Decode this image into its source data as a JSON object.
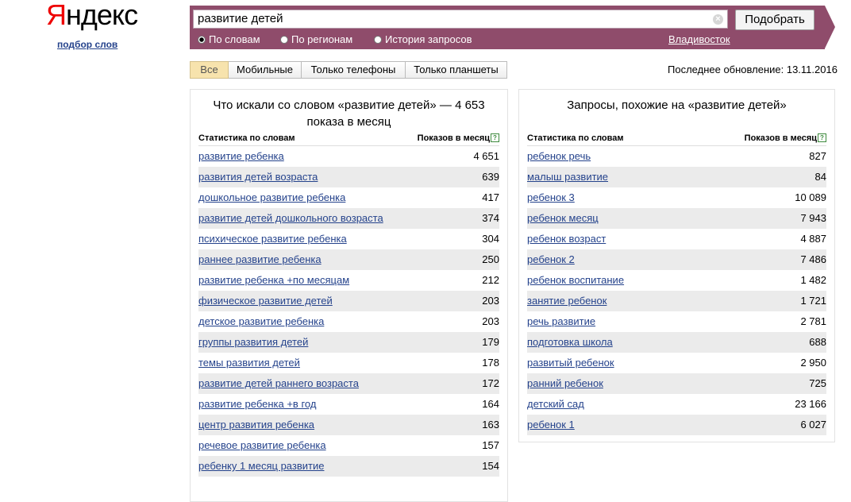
{
  "logo": {
    "first": "Я",
    "rest": "ндекс",
    "subtitle": "подбор слов"
  },
  "search": {
    "value": "развитие детей",
    "clear_icon": "×",
    "submit_label": "Подобрать"
  },
  "radios": [
    {
      "label": "По словам",
      "selected": true
    },
    {
      "label": "По регионам",
      "selected": false
    },
    {
      "label": "История запросов",
      "selected": false
    }
  ],
  "region": "Владивосток",
  "tabs": [
    {
      "label": "Все",
      "active": true
    },
    {
      "label": "Мобильные",
      "active": false
    },
    {
      "label": "Только телефоны",
      "active": false
    },
    {
      "label": "Только планшеты",
      "active": false
    }
  ],
  "last_update": "Последнее обновление: 13.11.2016",
  "left": {
    "title": "Что искали со словом «развитие детей» — 4 653 показа в месяц",
    "col_keyword": "Статистика по словам",
    "col_count": "Показов в месяц",
    "help_icon": "?",
    "rows": [
      {
        "keyword": "развитие ребенка",
        "count": "4 651"
      },
      {
        "keyword": "развития детей возраста",
        "count": "639"
      },
      {
        "keyword": "дошкольное развитие ребенка",
        "count": "417"
      },
      {
        "keyword": "развитие детей дошкольного возраста",
        "count": "374"
      },
      {
        "keyword": "психическое развитие ребенка",
        "count": "304"
      },
      {
        "keyword": "раннее развитие ребенка",
        "count": "250"
      },
      {
        "keyword": "развитие ребенка +по месяцам",
        "count": "212"
      },
      {
        "keyword": "физическое развитие детей",
        "count": "203"
      },
      {
        "keyword": "детское развитие ребенка",
        "count": "203"
      },
      {
        "keyword": "группы развития детей",
        "count": "179"
      },
      {
        "keyword": "темы развития детей",
        "count": "178"
      },
      {
        "keyword": "развитие детей раннего возраста",
        "count": "172"
      },
      {
        "keyword": "развитие ребенка +в год",
        "count": "164"
      },
      {
        "keyword": "центр развития ребенка",
        "count": "163"
      },
      {
        "keyword": "речевое развитие ребенка",
        "count": "157"
      },
      {
        "keyword": "ребенку 1 месяц развитие",
        "count": "154"
      },
      {
        "keyword": "",
        "count": ""
      }
    ]
  },
  "right": {
    "title": "Запросы, похожие на «развитие детей»",
    "col_keyword": "Статистика по словам",
    "col_count": "Показов в месяц",
    "help_icon": "?",
    "rows": [
      {
        "keyword": "ребенок речь",
        "count": "827"
      },
      {
        "keyword": "малыш развитие",
        "count": "84"
      },
      {
        "keyword": "ребенок 3",
        "count": "10 089"
      },
      {
        "keyword": "ребенок месяц",
        "count": "7 943"
      },
      {
        "keyword": "ребенок возраст",
        "count": "4 887"
      },
      {
        "keyword": "ребенок 2",
        "count": "7 486"
      },
      {
        "keyword": "ребенок воспитание",
        "count": "1 482"
      },
      {
        "keyword": "занятие ребенок",
        "count": "1 721"
      },
      {
        "keyword": "речь развитие",
        "count": "2 781"
      },
      {
        "keyword": "подготовка школа",
        "count": "688"
      },
      {
        "keyword": "развитый ребенок",
        "count": "2 950"
      },
      {
        "keyword": "ранний ребенок",
        "count": "725"
      },
      {
        "keyword": "детский сад",
        "count": "23 166"
      },
      {
        "keyword": "ребенок 1",
        "count": "6 027"
      }
    ]
  }
}
